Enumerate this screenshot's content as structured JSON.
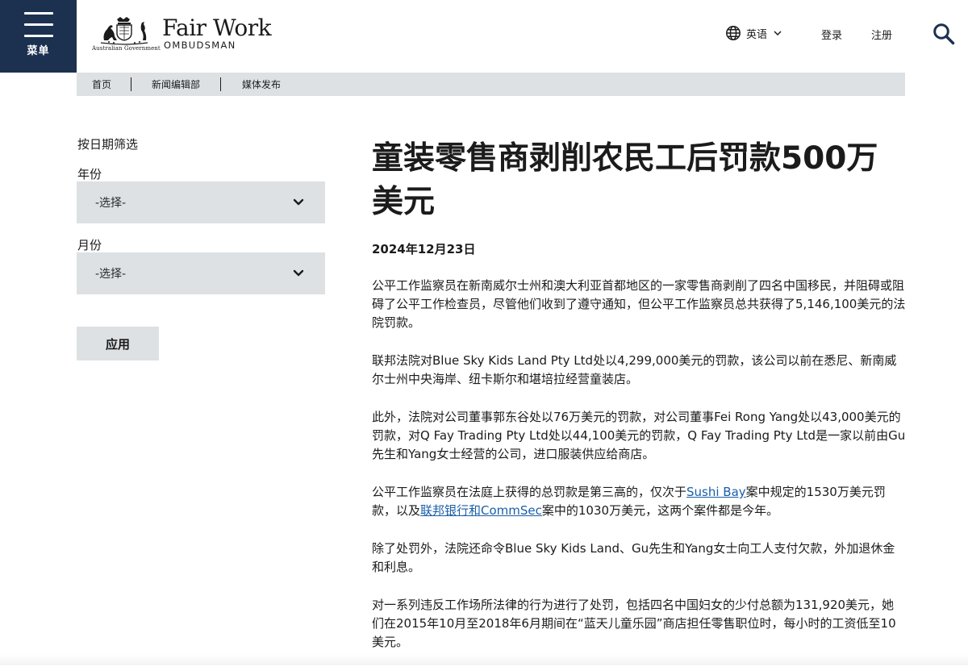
{
  "header": {
    "menu_label": "菜单",
    "gov_label": "Australian Government",
    "brand_title": "Fair Work",
    "brand_subtitle": "OMBUDSMAN",
    "language_label": "英语",
    "login_label": "登录",
    "register_label": "注册"
  },
  "breadcrumb": {
    "items": [
      "首页",
      "新闻编辑部",
      "媒体发布"
    ]
  },
  "filter": {
    "heading": "按日期筛选",
    "year_label": "年份",
    "year_value": "-选择-",
    "month_label": "月份",
    "month_value": "-选择-",
    "apply_label": "应用"
  },
  "article": {
    "title": "童装零售商剥削农民工后罚款500万美元",
    "date": "2024年12月23日",
    "p1": "公平工作监察员在新南威尔士州和澳大利亚首都地区的一家零售商剥削了四名中国移民，并阻碍或阻碍了公平工作检查员，尽管他们收到了遵守通知，但公平工作监察员总共获得了5,146,100美元的法院罚款。",
    "p2": "联邦法院对Blue Sky Kids Land Pty Ltd处以4,299,000美元的罚款，该公司以前在悉尼、新南威尔士州中央海岸、纽卡斯尔和堪培拉经营童装店。",
    "p3": "此外，法院对公司董事郭东谷处以76万美元的罚款，对公司董事Fei Rong Yang处以43,000美元的罚款，对Q Fay Trading Pty Ltd处以44,100美元的罚款，Q Fay Trading Pty Ltd是一家以前由Gu先生和Yang女士经营的公司，进口服装供应给商店。",
    "p4_a": "公平工作监察员在法庭上获得的总罚款是第三高的，仅次于",
    "p4_link1": "Sushi Bay",
    "p4_b": "案中规定的1530万美元罚款，以及",
    "p4_link2": "联邦银行和CommSec",
    "p4_c": "案中的1030万美元，这两个案件都是今年。",
    "p5": "除了处罚外，法院还命令Blue Sky Kids Land、Gu先生和Yang女士向工人支付欠款，外加退休金和利息。",
    "p6": "对一系列违反工作场所法律的行为进行了处罚，包括四名中国妇女的少付总额为131,920美元，她们在2015年10月至2018年6月期间在“蓝天儿童乐园”商店担任零售职位时，每小时的工资低至10美元。"
  },
  "colors": {
    "menu_bg": "#1c3150",
    "panel_bg": "#dde1e4",
    "link": "#1a5ea8",
    "text": "#1b1b1b"
  },
  "icons": [
    "menu-icon",
    "coat-of-arms-logo",
    "globe-icon",
    "chevron-down-icon",
    "search-icon"
  ]
}
